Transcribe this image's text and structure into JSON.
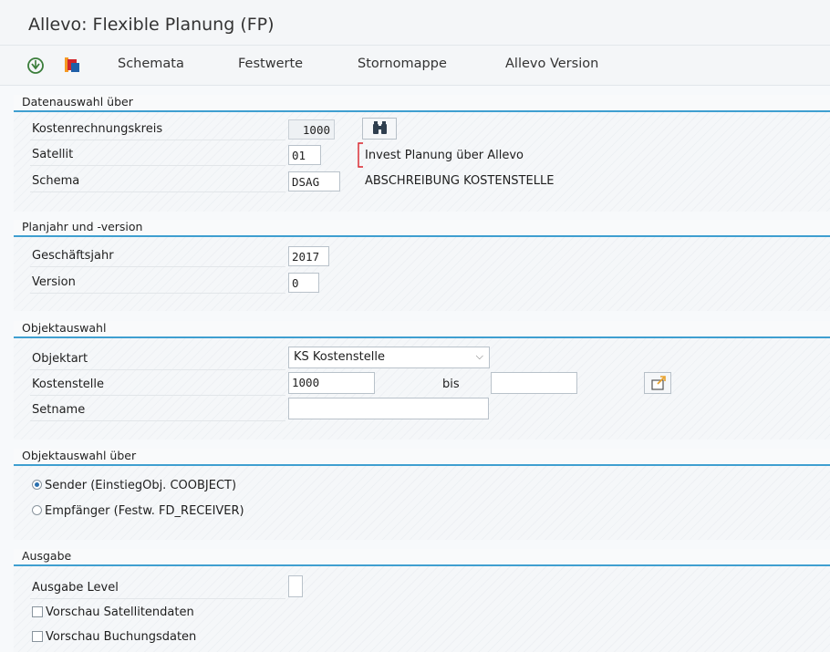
{
  "window": {
    "title": "Allevo: Flexible Planung (FP)"
  },
  "toolbar": {
    "icons": [
      "execute-icon",
      "copy-documents-icon"
    ],
    "buttons": [
      "Schemata",
      "Festwerte",
      "Stornomappe",
      "Allevo Version"
    ]
  },
  "datenauswahl": {
    "header": "Datenauswahl über",
    "kostenrechnungskreis_label": "Kostenrechnungskreis",
    "kostenrechnungskreis_value": "1000",
    "satellit_label": "Satellit",
    "satellit_value": "01",
    "satellit_text": "Invest Planung über Allevo",
    "schema_label": "Schema",
    "schema_value": "DSAG",
    "schema_text": "ABSCHREIBUNG KOSTENSTELLE"
  },
  "planjahr": {
    "header": "Planjahr und -version",
    "geschaeftsjahr_label": "Geschäftsjahr",
    "geschaeftsjahr_value": "2017",
    "version_label": "Version",
    "version_value": "0"
  },
  "objektauswahl": {
    "header": "Objektauswahl",
    "objektart_label": "Objektart",
    "objektart_value": "KS Kostenstelle",
    "kostenstelle_label": "Kostenstelle",
    "kostenstelle_from": "1000",
    "bis_label": "bis",
    "kostenstelle_to": "",
    "setname_label": "Setname",
    "setname_value": ""
  },
  "objektauswahl_ueber": {
    "header": "Objektauswahl über",
    "options": [
      {
        "label": "Sender (EinstiegObj. COOBJECT)",
        "selected": true
      },
      {
        "label": "Empfänger (Festw. FD_RECEIVER)",
        "selected": false
      }
    ]
  },
  "ausgabe": {
    "header": "Ausgabe",
    "level_label": "Ausgabe Level",
    "level_value": "",
    "checkboxes": [
      {
        "label": "Vorschau Satellitendaten",
        "checked": false
      },
      {
        "label": "Vorschau Buchungsdaten",
        "checked": false
      }
    ]
  },
  "colors": {
    "accent": "#3f9fd0",
    "execute_icon": "#3a7d3a",
    "copy_icon_red": "#d2232a",
    "copy_icon_orange": "#f59a23",
    "copy_icon_blue": "#1f5fa8"
  }
}
